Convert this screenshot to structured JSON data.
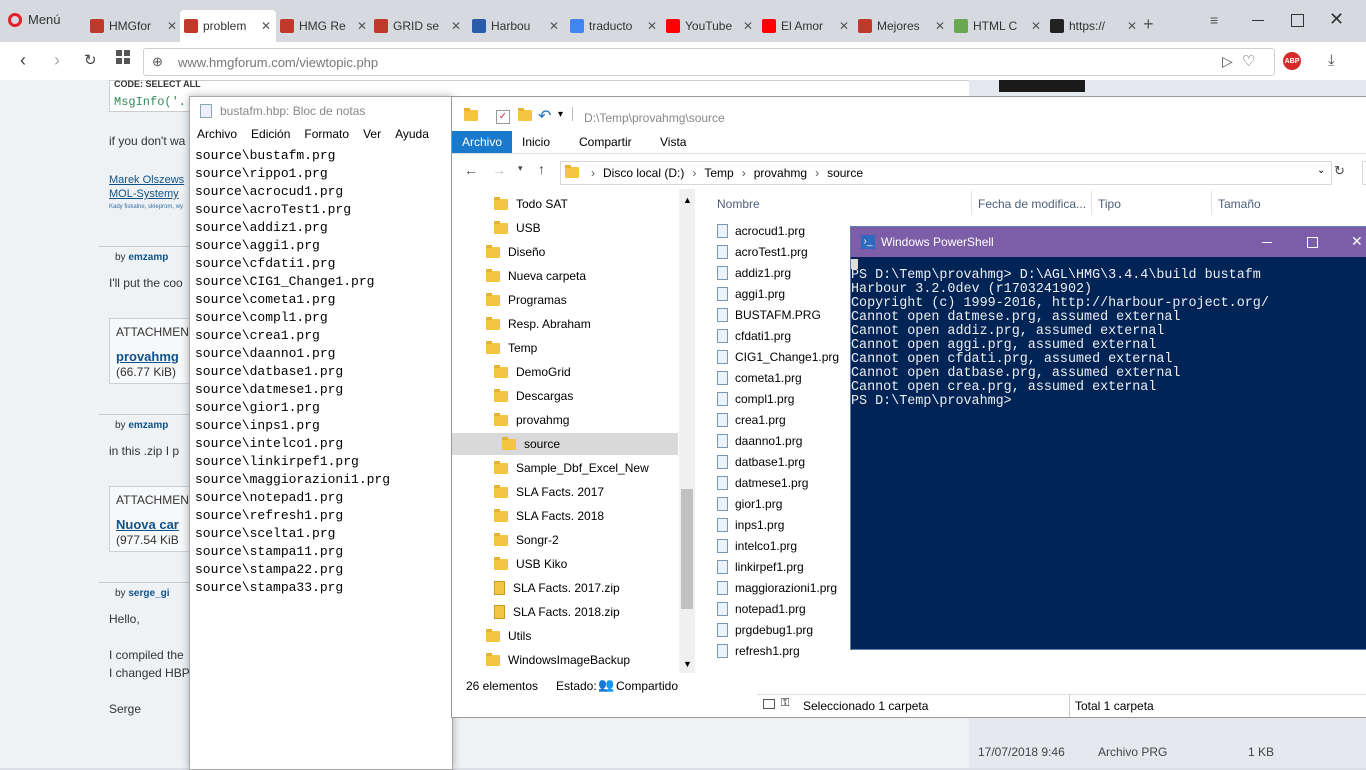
{
  "browser": {
    "menu_label": "Menú",
    "tabs": [
      "HMGfor",
      "problem",
      "HMG Re",
      "GRID se",
      "Harbou",
      "traducto",
      "YouTube",
      "El Amor",
      "Mejores",
      "HTML C",
      "https://"
    ],
    "url": "www.hmgforum.com/viewtopic.php"
  },
  "forum": {
    "code_label": "CODE: SELECT ALL",
    "code_line": "MsgInfo('..",
    "post1_text": "if you don't wa",
    "sig1": "Marek Olszews",
    "sig2": "MOL-Systemy",
    "sig3": "Kady fiskalne, skleprom, wy",
    "by": "by",
    "author1": "emzamp",
    "post2_text": "I'll put the coo",
    "attachments": "ATTACHMEN",
    "att1_name": "provahmg",
    "att1_size": "(66.77 KiB)",
    "author2": "emzamp",
    "post3_text": "in this .zip I p",
    "att2_name": "Nuova car",
    "att2_size": "(977.54 KiB",
    "author3": "serge_gi",
    "hello": "Hello,",
    "compiled": "I compiled the",
    "changed": "I changed HBP",
    "serge": "Serge"
  },
  "notepad": {
    "title": "bustafm.hbp: Bloc de notas",
    "menu": [
      "Archivo",
      "Edición",
      "Formato",
      "Ver",
      "Ayuda"
    ],
    "lines": [
      "source\\bustafm.prg",
      "source\\rippo1.prg",
      "source\\acrocud1.prg",
      "source\\acroTest1.prg",
      "source\\addiz1.prg",
      "source\\aggi1.prg",
      "source\\cfdati1.prg",
      "source\\CIG1_Change1.prg",
      "source\\cometa1.prg",
      "source\\compl1.prg",
      "source\\crea1.prg",
      "source\\daanno1.prg",
      "source\\datbase1.prg",
      "source\\datmese1.prg",
      "source\\gior1.prg",
      "source\\inps1.prg",
      "source\\intelco1.prg",
      "source\\linkirpef1.prg",
      "source\\maggiorazioni1.prg",
      "source\\notepad1.prg",
      "source\\refresh1.prg",
      "source\\scelta1.prg",
      "source\\stampa11.prg",
      "source\\stampa22.prg",
      "source\\stampa33.prg"
    ]
  },
  "explorer": {
    "title_path": "D:\\Temp\\provahmg\\source",
    "ribbon_tabs": [
      "Archivo",
      "Inicio",
      "Compartir",
      "Vista"
    ],
    "breadcrumb": [
      "Disco local (D:)",
      "Temp",
      "provahmg",
      "source"
    ],
    "tree": [
      {
        "label": "Todo SAT",
        "type": "folder",
        "indent": 1
      },
      {
        "label": "USB",
        "type": "folder",
        "indent": 1
      },
      {
        "label": "Diseño",
        "type": "folder",
        "indent": 0
      },
      {
        "label": "Nueva carpeta",
        "type": "folder",
        "indent": 0
      },
      {
        "label": "Programas",
        "type": "folder",
        "indent": 0
      },
      {
        "label": "Resp. Abraham",
        "type": "folder",
        "indent": 0
      },
      {
        "label": "Temp",
        "type": "folder",
        "indent": 0
      },
      {
        "label": "DemoGrid",
        "type": "folder",
        "indent": 1
      },
      {
        "label": "Descargas",
        "type": "folder",
        "indent": 1
      },
      {
        "label": "provahmg",
        "type": "folder",
        "indent": 1
      },
      {
        "label": "source",
        "type": "folder",
        "indent": 2,
        "selected": true
      },
      {
        "label": "Sample_Dbf_Excel_New",
        "type": "folder",
        "indent": 1
      },
      {
        "label": "SLA Facts. 2017",
        "type": "folder",
        "indent": 1
      },
      {
        "label": "SLA Facts. 2018",
        "type": "folder",
        "indent": 1
      },
      {
        "label": "Songr-2",
        "type": "folder",
        "indent": 1
      },
      {
        "label": "USB Kiko",
        "type": "folder",
        "indent": 1
      },
      {
        "label": "SLA Facts. 2017.zip",
        "type": "zip",
        "indent": 1
      },
      {
        "label": "SLA Facts. 2018.zip",
        "type": "zip",
        "indent": 1
      },
      {
        "label": "Utils",
        "type": "folder",
        "indent": 0
      },
      {
        "label": "WindowsImageBackup",
        "type": "folder",
        "indent": 0
      }
    ],
    "columns": [
      "Nombre",
      "Fecha de modifica...",
      "Tipo",
      "Tamaño"
    ],
    "files": [
      "acrocud1.prg",
      "acroTest1.prg",
      "addiz1.prg",
      "aggi1.prg",
      "BUSTAFM.PRG",
      "cfdati1.prg",
      "CIG1_Change1.prg",
      "cometa1.prg",
      "compl1.prg",
      "crea1.prg",
      "daanno1.prg",
      "datbase1.prg",
      "datmese1.prg",
      "gior1.prg",
      "inps1.prg",
      "intelco1.prg",
      "linkirpef1.prg",
      "maggiorazioni1.prg",
      "notepad1.prg",
      "prgdebug1.prg",
      "refresh1.prg"
    ],
    "last_row_date": "17/07/2018 9:46",
    "last_row_type": "Archivo PRG",
    "last_row_size": "1 KB",
    "status_count": "26 elementos",
    "status_state": "Estado:",
    "status_shared": "Compartido"
  },
  "status2": {
    "selected": "Seleccionado 1 carpeta",
    "total": "Total 1 carpeta"
  },
  "powershell": {
    "title": "Windows PowerShell",
    "lines": [
      "PS D:\\Temp\\provahmg> D:\\AGL\\HMG\\3.4.4\\build bustafm",
      "Harbour 3.2.0dev (r1703241902)",
      "Copyright (c) 1999-2016, http://harbour-project.org/",
      "Cannot open datmese.prg, assumed external",
      "Cannot open addiz.prg, assumed external",
      "Cannot open aggi.prg, assumed external",
      "Cannot open cfdati.prg, assumed external",
      "Cannot open datbase.prg, assumed external",
      "Cannot open crea.prg, assumed external",
      "PS D:\\Temp\\provahmg>"
    ]
  },
  "colors": {
    "ps_bg": "#012456",
    "ps_title": "#7b5ea7",
    "folder": "#f5c542",
    "link": "#105289"
  }
}
